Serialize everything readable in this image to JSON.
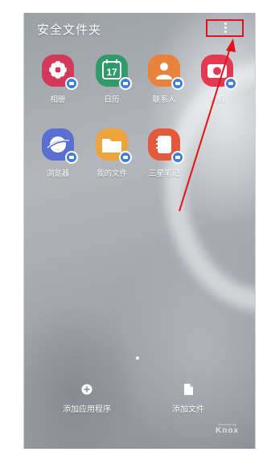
{
  "header": {
    "title": "安全文件夹"
  },
  "apps": [
    {
      "label": "相册",
      "icon": "gallery-icon",
      "color": "#d2395b"
    },
    {
      "label": "日历",
      "icon": "calendar-icon",
      "color": "#2f9b6b",
      "day": "17"
    },
    {
      "label": "联系人",
      "icon": "contacts-icon",
      "color": "#e9823c"
    },
    {
      "label": "相机",
      "icon": "camera-icon",
      "color": "#e43954"
    },
    {
      "label": "浏览器",
      "icon": "browser-icon",
      "color": "#5b6fd1"
    },
    {
      "label": "我的文件",
      "icon": "my-files-icon",
      "color": "#eea43c"
    },
    {
      "label": "三星笔记",
      "icon": "samsung-notes-icon",
      "color": "#e4583c"
    }
  ],
  "actions": {
    "add_apps": {
      "label": "添加应用程序",
      "icon": "plus-circle-icon"
    },
    "add_files": {
      "label": "添加文件",
      "icon": "file-icon"
    }
  },
  "knox": {
    "secured_by": "Secured by",
    "brand": "Knox"
  },
  "annotation": {
    "highlight_color": "#e0121b"
  }
}
